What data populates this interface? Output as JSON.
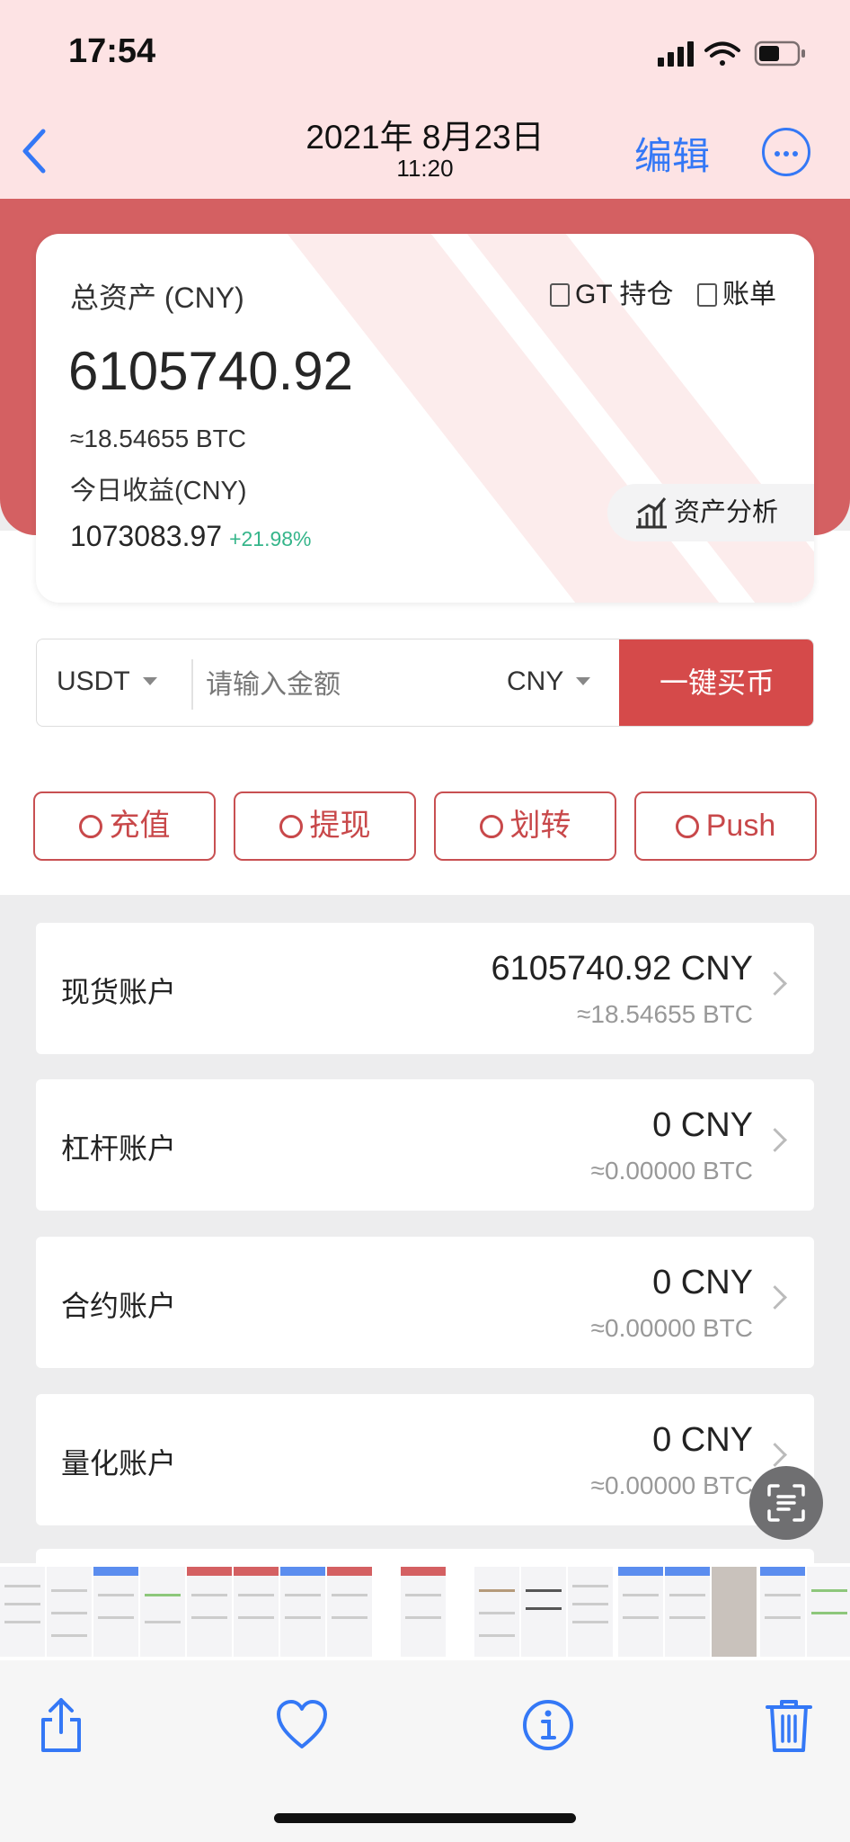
{
  "status_bar": {
    "time": "17:54"
  },
  "nav": {
    "date": "2021年 8月23日",
    "time": "11:20",
    "edit_label": "编辑"
  },
  "asset_card": {
    "total_label": "总资产 (CNY)",
    "gt_label": "GT 持仓",
    "bill_label": "账单",
    "total_value": "6105740.92",
    "btc_equiv": "≈18.54655 BTC",
    "today_label": "今日收益(CNY)",
    "today_value": "1073083.97",
    "today_pct": "+21.98%",
    "analysis_label": "资产分析"
  },
  "buy": {
    "coin": "USDT",
    "amount_placeholder": "请输入金额",
    "fiat": "CNY",
    "button_label": "一键买币"
  },
  "actions": [
    {
      "label": "充值"
    },
    {
      "label": "提现"
    },
    {
      "label": "划转"
    },
    {
      "label": "Push"
    }
  ],
  "accounts": [
    {
      "name": "现货账户",
      "value": "6105740.92 CNY",
      "btc": "≈18.54655 BTC"
    },
    {
      "name": "杠杆账户",
      "value": "0 CNY",
      "btc": "≈0.00000 BTC"
    },
    {
      "name": "合约账户",
      "value": "0 CNY",
      "btc": "≈0.00000 BTC"
    },
    {
      "name": "量化账户",
      "value": "0 CNY",
      "btc": "≈0.00000 BTC"
    }
  ],
  "colors": {
    "accent_blue": "#3478f6",
    "brand_red": "#d54a4a",
    "positive_green": "#35b58a"
  },
  "toolbar_icons": [
    "share-icon",
    "heart-icon",
    "info-icon",
    "trash-icon"
  ]
}
